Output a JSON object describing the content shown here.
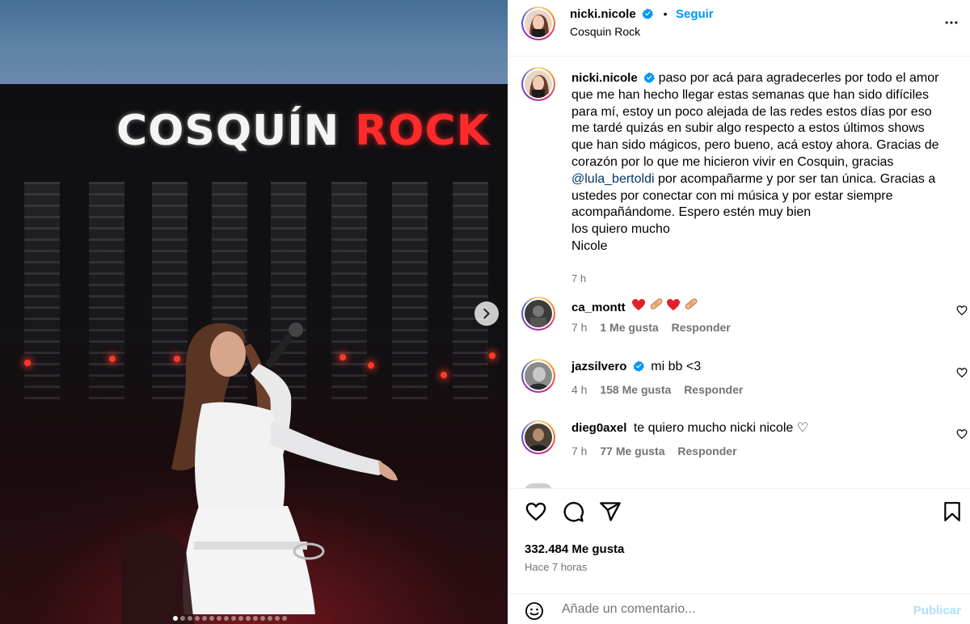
{
  "post": {
    "logo_left": "COSQUÍN",
    "logo_right": "ROCK",
    "carousel_dots": 16,
    "carousel_active": 1
  },
  "header": {
    "username": "nicki.nicole",
    "separator": "•",
    "follow_label": "Seguir",
    "location": "Cosquin Rock",
    "more_icon": "more-horizontal-icon"
  },
  "caption": {
    "username": "nicki.nicole",
    "text_before_mention": "paso por acá para agradecerles por todo el amor que me han hecho llegar estas semanas que han sido difíciles para mí, estoy un poco alejada de las redes estos días por eso me tardé quizás en subir algo respecto a estos últimos shows que han sido mágicos, pero bueno, acá estoy ahora. Gracias de corazón por lo que me hicieron vivir en Cosquin, gracias",
    "mention": "@lula_bertoldi",
    "text_after_mention": "por acompañarme y por ser tan única. Gracias a ustedes por conectar con mi música y por estar siempre acompañándome. Espero estén muy bien",
    "line2": "los quiero mucho",
    "line3": "Nicole",
    "time": "7 h"
  },
  "comments": [
    {
      "username": "ca_montt",
      "text": "",
      "emojis": [
        "heart",
        "bandage",
        "heart",
        "bandage"
      ],
      "verified": false,
      "time": "7 h",
      "likes": "1 Me gusta",
      "reply": "Responder"
    },
    {
      "username": "jazsilvero",
      "text": "mi bb <3",
      "verified": true,
      "time": "4 h",
      "likes": "158 Me gusta",
      "reply": "Responder"
    },
    {
      "username": "dieg0axel",
      "text": "te quiero mucho nicki nicole ♡",
      "verified": false,
      "time": "7 h",
      "likes": "77 Me gusta",
      "reply": "Responder"
    }
  ],
  "actions": {
    "likes_count": "332.484 Me gusta",
    "time_ago": "Hace 7 horas"
  },
  "composer": {
    "placeholder": "Añade un comentario...",
    "publish_label": "Publicar"
  },
  "colors": {
    "accent_blue": "#0095f6",
    "muted": "#737373",
    "mention": "#00376b",
    "publish_disabled": "#b2dffc",
    "verified": "#0095f6"
  }
}
